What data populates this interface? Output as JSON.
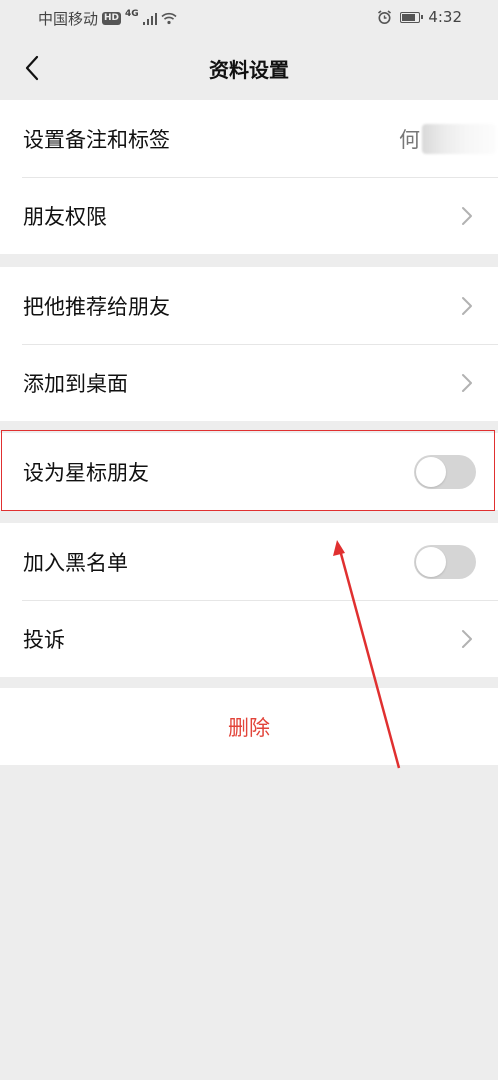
{
  "status_bar": {
    "carrier": "中国移动",
    "hd": "HD",
    "network": "4G",
    "time": "4:32"
  },
  "nav": {
    "title": "资料设置"
  },
  "groups": {
    "profile": {
      "remark_label": "设置备注和标签",
      "remark_value": "何",
      "permissions_label": "朋友权限"
    },
    "share": {
      "recommend_label": "把他推荐给朋友",
      "desktop_label": "添加到桌面"
    },
    "star": {
      "star_label": "设为星标朋友",
      "star_enabled": false
    },
    "block": {
      "blacklist_label": "加入黑名单",
      "blacklist_enabled": false,
      "complain_label": "投诉"
    }
  },
  "delete": {
    "label": "删除",
    "color": "#e2443a"
  },
  "annotation": {
    "color": "#e03030"
  }
}
